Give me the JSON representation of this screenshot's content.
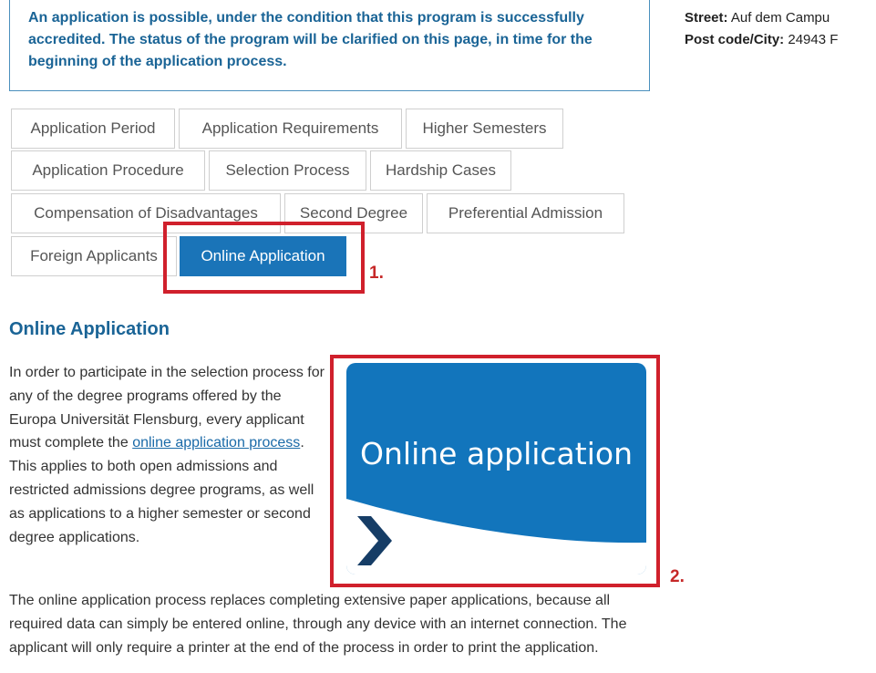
{
  "notice": {
    "text": "An application is possible, under the condition that this program is successfully accredited. The status of the program will be clarified on this page, in time for the beginning of the application process."
  },
  "address": {
    "street_label": "Street:",
    "street_value": "Auf dem Campu",
    "postcode_label": "Post code/City:",
    "postcode_value": "24943 F"
  },
  "tabs": [
    {
      "label": "Application Period",
      "active": false
    },
    {
      "label": "Application Requirements",
      "active": false
    },
    {
      "label": "Higher Semesters",
      "active": false
    },
    {
      "label": "Application Procedure",
      "active": false
    },
    {
      "label": "Selection Process",
      "active": false
    },
    {
      "label": "Hardship Cases",
      "active": false
    },
    {
      "label": "Compensation of Disadvantages",
      "active": false
    },
    {
      "label": "Second Degree",
      "active": false
    },
    {
      "label": "Preferential Admission",
      "active": false
    },
    {
      "label": "Foreign Applicants",
      "active": false
    },
    {
      "label": "Online Application",
      "active": true
    }
  ],
  "annotations": {
    "step1": "1.",
    "step2": "2.",
    "highlight_color": "#d0202c"
  },
  "section": {
    "title": "Online Application",
    "para1_before": "In order to participate in the selection process for any of the degree programs offered by the Europa Universität Flensburg, every applicant must complete the",
    "para1_link": "online application process",
    "para1_after": ". This applies to both open admissions and restricted admissions degree programs, as well as applications to a higher semester or second degree applications.",
    "para2": "The online application process replaces completing extensive paper applications, because all required data can simply be entered online, through any device with an internet connection. The applicant will only require a printer at the end of the process in order to print the application."
  },
  "promo": {
    "label": "Online application",
    "icon": "chevron-right-icon",
    "colors": {
      "background": "#1275bc",
      "chevron": "#163d66",
      "accent": "#ffffff"
    }
  }
}
